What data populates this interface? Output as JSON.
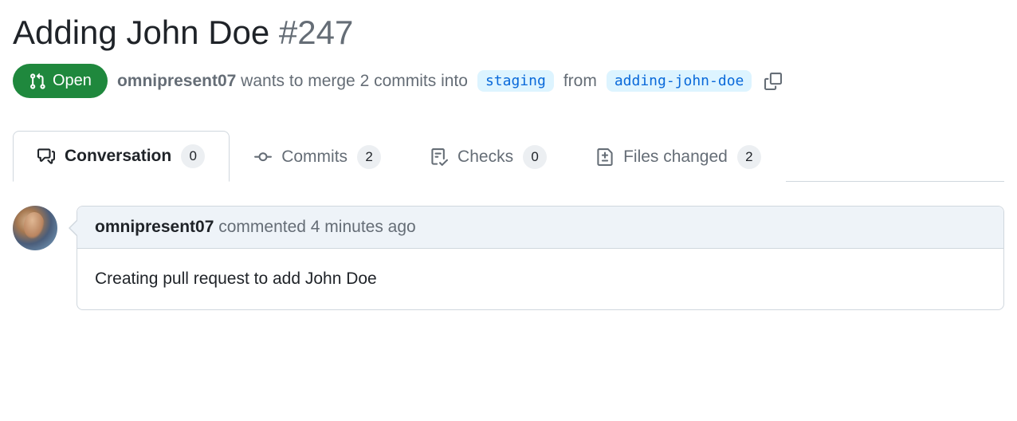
{
  "colors": {
    "open_state": "#1f883d",
    "branch_bg": "#ddf4ff",
    "branch_fg": "#0969da"
  },
  "header": {
    "title": "Adding John Doe",
    "number": "#247",
    "state_label": "Open",
    "author": "omnipresent07",
    "merge_text_1": "wants to merge 2 commits into",
    "base_branch": "staging",
    "merge_text_2": "from",
    "head_branch": "adding-john-doe"
  },
  "tabs": {
    "conversation": {
      "label": "Conversation",
      "count": "0"
    },
    "commits": {
      "label": "Commits",
      "count": "2"
    },
    "checks": {
      "label": "Checks",
      "count": "0"
    },
    "files": {
      "label": "Files changed",
      "count": "2"
    }
  },
  "comment": {
    "author": "omnipresent07",
    "action": "commented",
    "timestamp": "4 minutes ago",
    "body": "Creating pull request to add John Doe"
  }
}
